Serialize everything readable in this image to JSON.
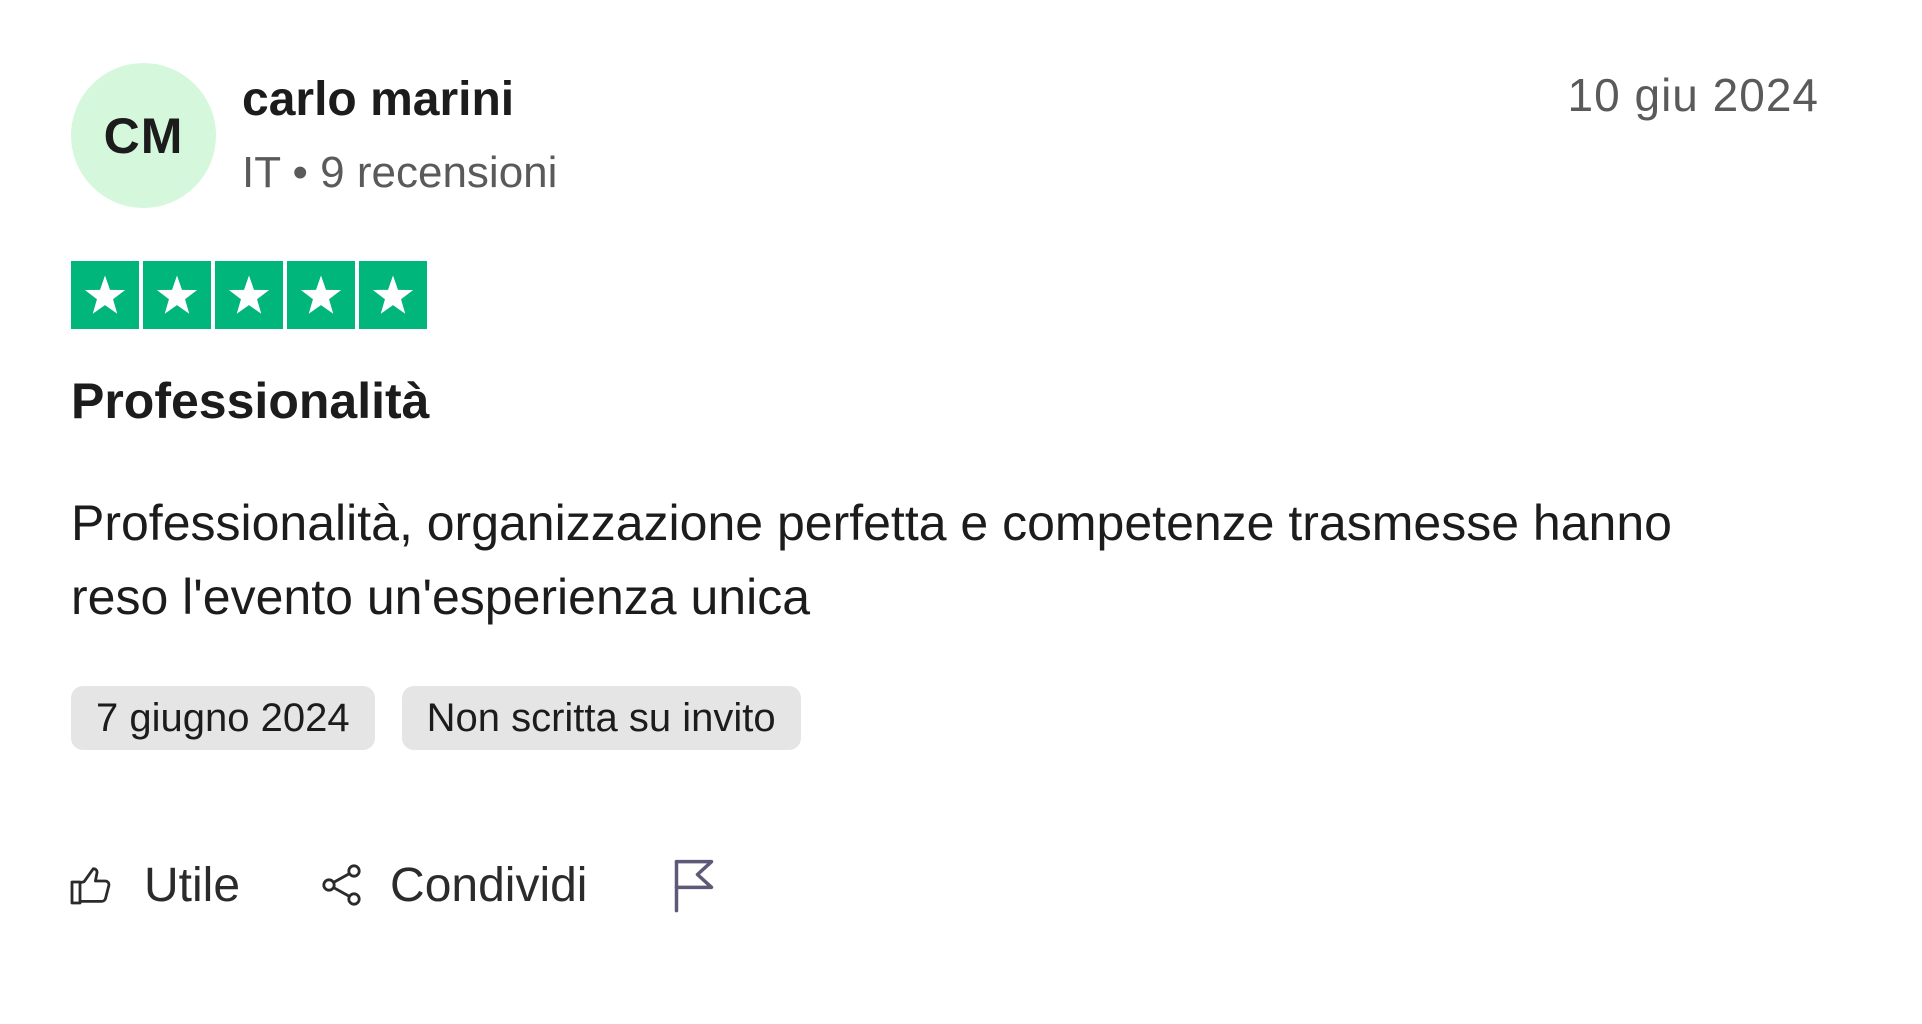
{
  "reviewer": {
    "initials": "CM",
    "name": "carlo marini",
    "meta": "IT • 9 recensioni",
    "avatar_color": "#d5f7dc"
  },
  "review": {
    "date": "10 giu 2024",
    "rating": 5,
    "rating_max": 5,
    "star_color": "#00b67a",
    "title": "Professionalità",
    "body": "Professionalità, organizzazione perfetta e competenze trasmesse hanno reso l'evento un'esperienza unica"
  },
  "badges": [
    "7 giugno 2024",
    "Non scritta su invito"
  ],
  "actions": {
    "useful_label": "Utile",
    "useful_icon": "thumbs-up-icon",
    "share_label": "Condividi",
    "share_icon": "share-icon",
    "report_icon": "flag-icon"
  }
}
